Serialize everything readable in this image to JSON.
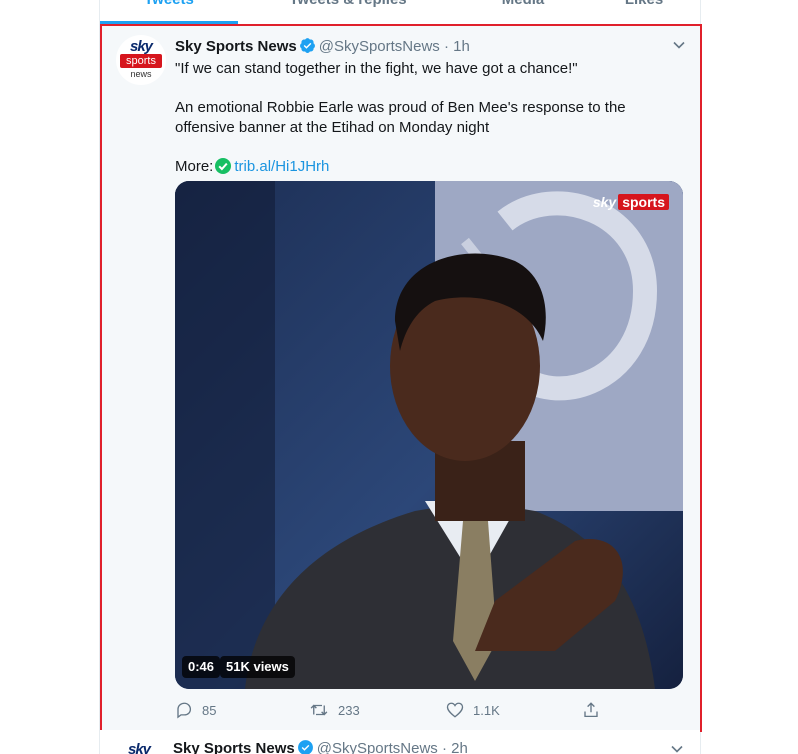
{
  "tabs": [
    {
      "label": "Tweets"
    },
    {
      "label": "Tweets & replies"
    },
    {
      "label": "Media"
    },
    {
      "label": "Likes"
    }
  ],
  "tweet": {
    "avatar": {
      "line1": "sky",
      "line2": "sports",
      "line3": "news"
    },
    "author_name": "Sky Sports News",
    "handle": "@SkySportsNews",
    "separator": "·",
    "time": "1h",
    "text_line1": "\"If we can stand together in the fight, we have got a chance!\"",
    "text_line2": "An emotional Robbie Earle was proud of Ben Mee's response to the offensive banner at the Etihad on Monday night",
    "more_label": "More:",
    "link": "trib.al/Hi1JHrh",
    "video": {
      "duration": "0:46",
      "views": "51K views",
      "logo_left": "sky",
      "logo_right": "sports"
    },
    "stats": {
      "replies": "85",
      "retweets": "233",
      "likes": "1.1K"
    }
  },
  "next_tweet": {
    "author_name": "Sky Sports News",
    "handle": "@SkySportsNews",
    "separator": "·",
    "time": "2h"
  },
  "colors": {
    "accent": "#1da1f2",
    "highlight_border": "#e0202b",
    "verified": "#1da1f2",
    "check": "#17bf63"
  }
}
